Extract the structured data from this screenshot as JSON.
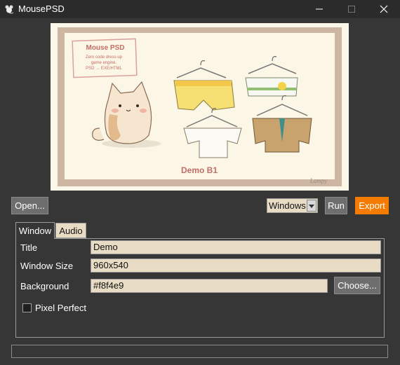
{
  "window": {
    "title": "MousePSD",
    "icon": "mouse-icon",
    "controls": [
      "minimize-icon",
      "maximize-icon",
      "close-icon"
    ]
  },
  "preview": {
    "image_text": {
      "sign_title": "Mouse PSD",
      "sign_lines": [
        "Zero code dress-up",
        "game engine.",
        "PSD → EXE/HTML"
      ],
      "caption": "Demo B1",
      "signature": "Lampy"
    }
  },
  "toolbar": {
    "open_label": "Open...",
    "platform_selected": "Windows",
    "run_label": "Run",
    "export_label": "Export"
  },
  "tabs": [
    {
      "label": "Window",
      "active": true
    },
    {
      "label": "Audio",
      "active": false
    }
  ],
  "window_settings": {
    "title_label": "Title",
    "title_value": "Demo",
    "size_label": "Window Size",
    "size_value": "960x540",
    "background_label": "Background",
    "background_value": "#f8f4e9",
    "choose_label": "Choose...",
    "pixel_perfect_label": "Pixel Perfect",
    "pixel_perfect_checked": false
  },
  "status": "",
  "colors": {
    "accent": "#f57c00",
    "field_bg": "#e8dcc4",
    "panel_bg": "#363636"
  }
}
